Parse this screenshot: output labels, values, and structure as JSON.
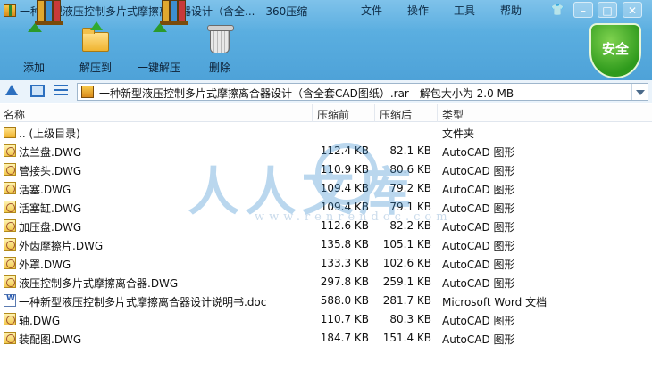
{
  "window": {
    "title": "一种新型液压控制多片式摩擦离合器设计（含全... - 360压缩",
    "menu": [
      "文件",
      "操作",
      "工具",
      "帮助"
    ]
  },
  "toolbar": {
    "add_label": "添加",
    "extract_to_label": "解压到",
    "one_click_extract_label": "一键解压",
    "delete_label": "删除"
  },
  "security": {
    "label": "安全"
  },
  "address": {
    "path": "一种新型液压控制多片式摩擦离合器设计（含全套CAD图纸）.rar - 解包大小为 2.0 MB"
  },
  "columns": {
    "name": "名称",
    "size": "压缩前",
    "packed": "压缩后",
    "type": "类型"
  },
  "files": [
    {
      "icon": "folder-icon",
      "name": ".. (上级目录)",
      "size": "",
      "packed": "",
      "type": "文件夹"
    },
    {
      "icon": "dwg-file-icon",
      "name": "法兰盘.DWG",
      "size": "112.4 KB",
      "packed": "82.1 KB",
      "type": "AutoCAD 图形"
    },
    {
      "icon": "dwg-file-icon",
      "name": "管接头.DWG",
      "size": "110.9 KB",
      "packed": "80.6 KB",
      "type": "AutoCAD 图形"
    },
    {
      "icon": "dwg-file-icon",
      "name": "活塞.DWG",
      "size": "109.4 KB",
      "packed": "79.2 KB",
      "type": "AutoCAD 图形"
    },
    {
      "icon": "dwg-file-icon",
      "name": "活塞缸.DWG",
      "size": "109.4 KB",
      "packed": "79.1 KB",
      "type": "AutoCAD 图形"
    },
    {
      "icon": "dwg-file-icon",
      "name": "加压盘.DWG",
      "size": "112.6 KB",
      "packed": "82.2 KB",
      "type": "AutoCAD 图形"
    },
    {
      "icon": "dwg-file-icon",
      "name": "外齿摩擦片.DWG",
      "size": "135.8 KB",
      "packed": "105.1 KB",
      "type": "AutoCAD 图形"
    },
    {
      "icon": "dwg-file-icon",
      "name": "外罩.DWG",
      "size": "133.3 KB",
      "packed": "102.6 KB",
      "type": "AutoCAD 图形"
    },
    {
      "icon": "dwg-file-icon",
      "name": "液压控制多片式摩擦离合器.DWG",
      "size": "297.8 KB",
      "packed": "259.1 KB",
      "type": "AutoCAD 图形"
    },
    {
      "icon": "doc-file-icon",
      "name": "一种新型液压控制多片式摩擦离合器设计说明书.doc",
      "size": "588.0 KB",
      "packed": "281.7 KB",
      "type": "Microsoft Word 文档"
    },
    {
      "icon": "dwg-file-icon",
      "name": "轴.DWG",
      "size": "110.7 KB",
      "packed": "80.3 KB",
      "type": "AutoCAD 图形"
    },
    {
      "icon": "dwg-file-icon",
      "name": "装配图.DWG",
      "size": "184.7 KB",
      "packed": "151.4 KB",
      "type": "AutoCAD 图形"
    }
  ],
  "watermark": {
    "text": "人人文库",
    "url": "www.renrendoc.com"
  },
  "colors": {
    "accent": "#4ea2d8",
    "shield": "#2e9a1c",
    "watermark": "#3b8fd1"
  }
}
